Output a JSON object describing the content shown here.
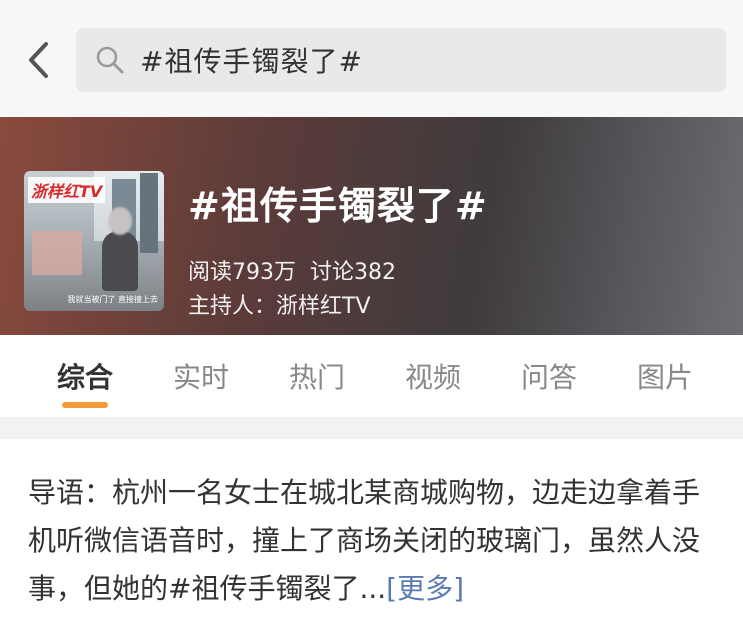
{
  "search": {
    "query": "#祖传手镯裂了#"
  },
  "topic": {
    "title": "#祖传手镯裂了#",
    "reads": "阅读793万",
    "discussions": "讨论382",
    "host": "主持人：浙样红TV",
    "thumbnail": {
      "logo_text": "浙样红TV",
      "caption": "我就当被门了 直接撞上去"
    }
  },
  "tabs": [
    {
      "label": "综合",
      "active": true
    },
    {
      "label": "实时",
      "active": false
    },
    {
      "label": "热门",
      "active": false
    },
    {
      "label": "视频",
      "active": false
    },
    {
      "label": "问答",
      "active": false
    },
    {
      "label": "图片",
      "active": false
    }
  ],
  "intro": {
    "text": "导语：杭州一名女士在城北某商城购物，边走边拿着手机听微信语音时，撞上了商场关闭的玻璃门，虽然人没事，但她的#祖传手镯裂了...",
    "more_label": "[更多]"
  },
  "colors": {
    "accent": "#f19b3a",
    "link": "#5b7ab3"
  }
}
